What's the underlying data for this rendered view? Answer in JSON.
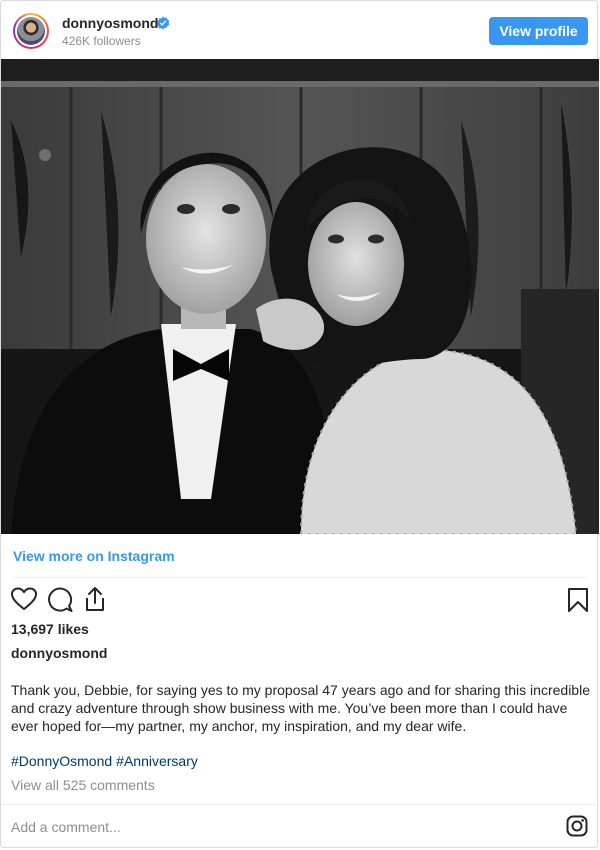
{
  "header": {
    "username": "donnyosmond",
    "followers": "426K followers",
    "view_profile_label": "View profile"
  },
  "post": {
    "view_more_label": "View more on Instagram",
    "likes": "13,697 likes",
    "author": "donnyosmond",
    "caption": "Thank you, Debbie, for saying yes to my proposal 47 years ago and for sharing this incredible and crazy adventure through show business with me. You’ve been more than I could have ever hoped for—my partner, my anchor, my inspiration, and my dear wife.",
    "hashtags": [
      "#DonnyOsmond",
      "#Anniversary"
    ],
    "comments_label": "View all 525 comments",
    "add_comment_placeholder": "Add a comment..."
  },
  "icons": {
    "like": "heart-icon",
    "comment": "comment-icon",
    "share": "share-icon",
    "save": "bookmark-icon",
    "instagram": "instagram-icon",
    "verified": "verified-badge-icon"
  },
  "colors": {
    "accent": "#3897f0",
    "hashtag": "#00376b",
    "muted": "#8e8e8e",
    "text": "#262626"
  }
}
